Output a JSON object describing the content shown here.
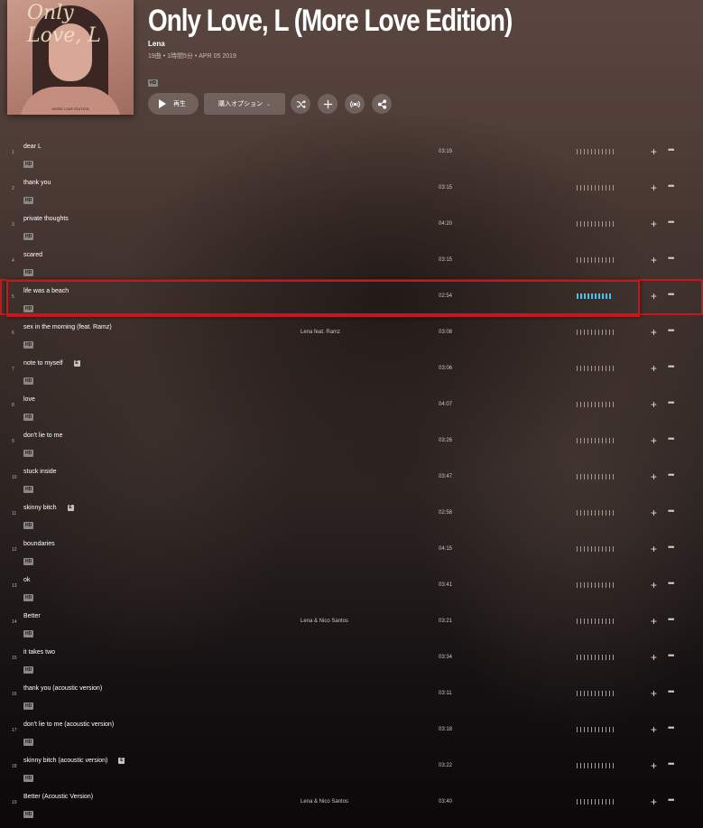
{
  "album": {
    "cover_script": "Only Love, L",
    "cover_caption": "MORE LOVE EDITION",
    "title": "Only Love, L (More Love Edition)",
    "artist": "Lena",
    "meta": "19曲 • 1時間5分 • APR 05 2019",
    "hd_badge": "HD"
  },
  "controls": {
    "play_label": "再生",
    "purchase_label": "購入オプション",
    "icons": [
      "shuffle-icon",
      "add-icon",
      "broadcast-icon",
      "share-icon"
    ]
  },
  "colors": {
    "accent_playing": "#3fc6f0",
    "selection_outline": "#c9161a"
  },
  "tracks": [
    {
      "num": "1",
      "title": "dear L",
      "explicit": "",
      "artist": "",
      "duration": "03:19",
      "hd": "HD"
    },
    {
      "num": "2",
      "title": "thank you",
      "explicit": "",
      "artist": "",
      "duration": "03:15",
      "hd": "HD"
    },
    {
      "num": "3",
      "title": "private thoughts",
      "explicit": "",
      "artist": "",
      "duration": "04:20",
      "hd": "HD"
    },
    {
      "num": "4",
      "title": "scared",
      "explicit": "",
      "artist": "",
      "duration": "03:15",
      "hd": "HD"
    },
    {
      "num": "5",
      "title": "life was a beach",
      "explicit": "",
      "artist": "",
      "duration": "02:54",
      "hd": "HD",
      "active": true
    },
    {
      "num": "6",
      "title": "sex in the morning (feat. Ramz)",
      "explicit": "",
      "artist": "Lena feat. Ramz",
      "duration": "03:08",
      "hd": "HD"
    },
    {
      "num": "7",
      "title": "note to myself",
      "explicit": "E",
      "artist": "",
      "duration": "03:06",
      "hd": "HD"
    },
    {
      "num": "8",
      "title": "love",
      "explicit": "",
      "artist": "",
      "duration": "04:07",
      "hd": "HD"
    },
    {
      "num": "9",
      "title": "don't lie to me",
      "explicit": "",
      "artist": "",
      "duration": "03:26",
      "hd": "HD"
    },
    {
      "num": "10",
      "title": "stuck inside",
      "explicit": "",
      "artist": "",
      "duration": "03:47",
      "hd": "HD"
    },
    {
      "num": "11",
      "title": "skinny bitch",
      "explicit": "E",
      "artist": "",
      "duration": "02:58",
      "hd": "HD"
    },
    {
      "num": "12",
      "title": "boundaries",
      "explicit": "",
      "artist": "",
      "duration": "04:15",
      "hd": "HD"
    },
    {
      "num": "13",
      "title": "ok",
      "explicit": "",
      "artist": "",
      "duration": "03:41",
      "hd": "HD"
    },
    {
      "num": "14",
      "title": "Better",
      "explicit": "",
      "artist": "Lena & Nico Santos",
      "duration": "03:21",
      "hd": "HD"
    },
    {
      "num": "15",
      "title": "it takes two",
      "explicit": "",
      "artist": "",
      "duration": "03:34",
      "hd": "HD"
    },
    {
      "num": "16",
      "title": "thank you (acoustic version)",
      "explicit": "",
      "artist": "",
      "duration": "03:11",
      "hd": "HD"
    },
    {
      "num": "17",
      "title": "don't lie to me (acoustic version)",
      "explicit": "",
      "artist": "",
      "duration": "03:18",
      "hd": "HD"
    },
    {
      "num": "18",
      "title": "skinny bitch (acoustic version)",
      "explicit": "E",
      "artist": "",
      "duration": "03:22",
      "hd": "HD"
    },
    {
      "num": "19",
      "title": "Better (Acoustic Version)",
      "explicit": "",
      "artist": "Lena & Nico Santos",
      "duration": "03:40",
      "hd": "HD"
    }
  ]
}
